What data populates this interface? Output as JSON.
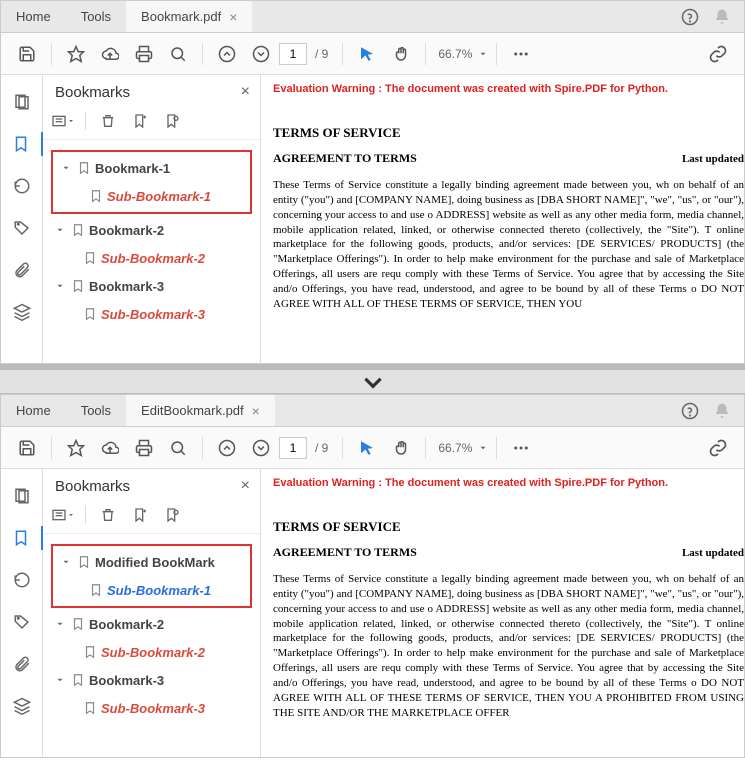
{
  "windows": [
    {
      "tabs": {
        "home": "Home",
        "tools": "Tools",
        "doc": "Bookmark.pdf"
      },
      "toolbar": {
        "page": "1",
        "total": "9",
        "zoom": "66.7%"
      },
      "panel": {
        "title": "Bookmarks",
        "bookmarks": [
          {
            "label": "Bookmark-1",
            "sub": "Sub-Bookmark-1",
            "sub_class": "styled-red"
          },
          {
            "label": "Bookmark-2",
            "sub": "Sub-Bookmark-2",
            "sub_class": "styled-red"
          },
          {
            "label": "Bookmark-3",
            "sub": "Sub-Bookmark-3",
            "sub_class": "styled-red"
          }
        ],
        "highlight_index": 0
      },
      "doc": {
        "warning": "Evaluation Warning : The document was created with Spire.PDF for Python.",
        "title": "TERMS OF SERVICE",
        "subtitle": "AGREEMENT TO TERMS",
        "updated": "Last updated",
        "body": "These Terms of Service constitute a legally binding agreement made between you, wh on behalf of an entity (\"you\") and [COMPANY NAME], doing business as [DBA SHORT NAME]\", \"we\", \"us\", or \"our\"), concerning your access to and use o ADDRESS] website as well as any other media form, media channel, mobile application related, linked, or otherwise connected thereto (collectively, the \"Site\"). T online marketplace for the following goods, products, and/or services: [DE SERVICES/ PRODUCTS] (the \"Marketplace Offerings\"). In order to help make environment for the purchase and sale of Marketplace Offerings, all users are requ comply with these Terms of Service. You agree that by accessing the Site and/o Offerings, you have read, understood, and agree to be bound by all of these Terms o DO NOT AGREE WITH ALL OF THESE TERMS OF SERVICE, THEN YOU"
      }
    },
    {
      "tabs": {
        "home": "Home",
        "tools": "Tools",
        "doc": "EditBookmark.pdf"
      },
      "toolbar": {
        "page": "1",
        "total": "9",
        "zoom": "66.7%"
      },
      "panel": {
        "title": "Bookmarks",
        "bookmarks": [
          {
            "label": "Modified BookMark",
            "sub": "Sub-Bookmark-1",
            "sub_class": "styled-blue"
          },
          {
            "label": "Bookmark-2",
            "sub": "Sub-Bookmark-2",
            "sub_class": "styled-red"
          },
          {
            "label": "Bookmark-3",
            "sub": "Sub-Bookmark-3",
            "sub_class": "styled-red"
          }
        ],
        "highlight_index": 0
      },
      "doc": {
        "warning": "Evaluation Warning : The document was created with Spire.PDF for Python.",
        "title": "TERMS OF SERVICE",
        "subtitle": "AGREEMENT TO TERMS",
        "updated": "Last updated",
        "body": "These Terms of Service constitute a legally binding agreement made between you, wh on behalf of an entity (\"you\") and [COMPANY NAME], doing business as [DBA SHORT NAME]\", \"we\", \"us\", or \"our\"), concerning your access to and use o ADDRESS] website as well as any other media form, media channel, mobile application related, linked, or otherwise connected thereto (collectively, the \"Site\"). T online marketplace for the following goods, products, and/or services: [DE SERVICES/ PRODUCTS] (the \"Marketplace Offerings\"). In order to help make environment for the purchase and sale of Marketplace Offerings, all users are requ comply with these Terms of Service. You agree that by accessing the Site and/o Offerings, you have read, understood, and agree to be bound by all of these Terms o DO NOT AGREE WITH ALL OF THESE TERMS OF SERVICE, THEN YOU A PROHIBITED FROM USING THE SITE AND/OR THE MARKETPLACE OFFER"
      }
    }
  ]
}
